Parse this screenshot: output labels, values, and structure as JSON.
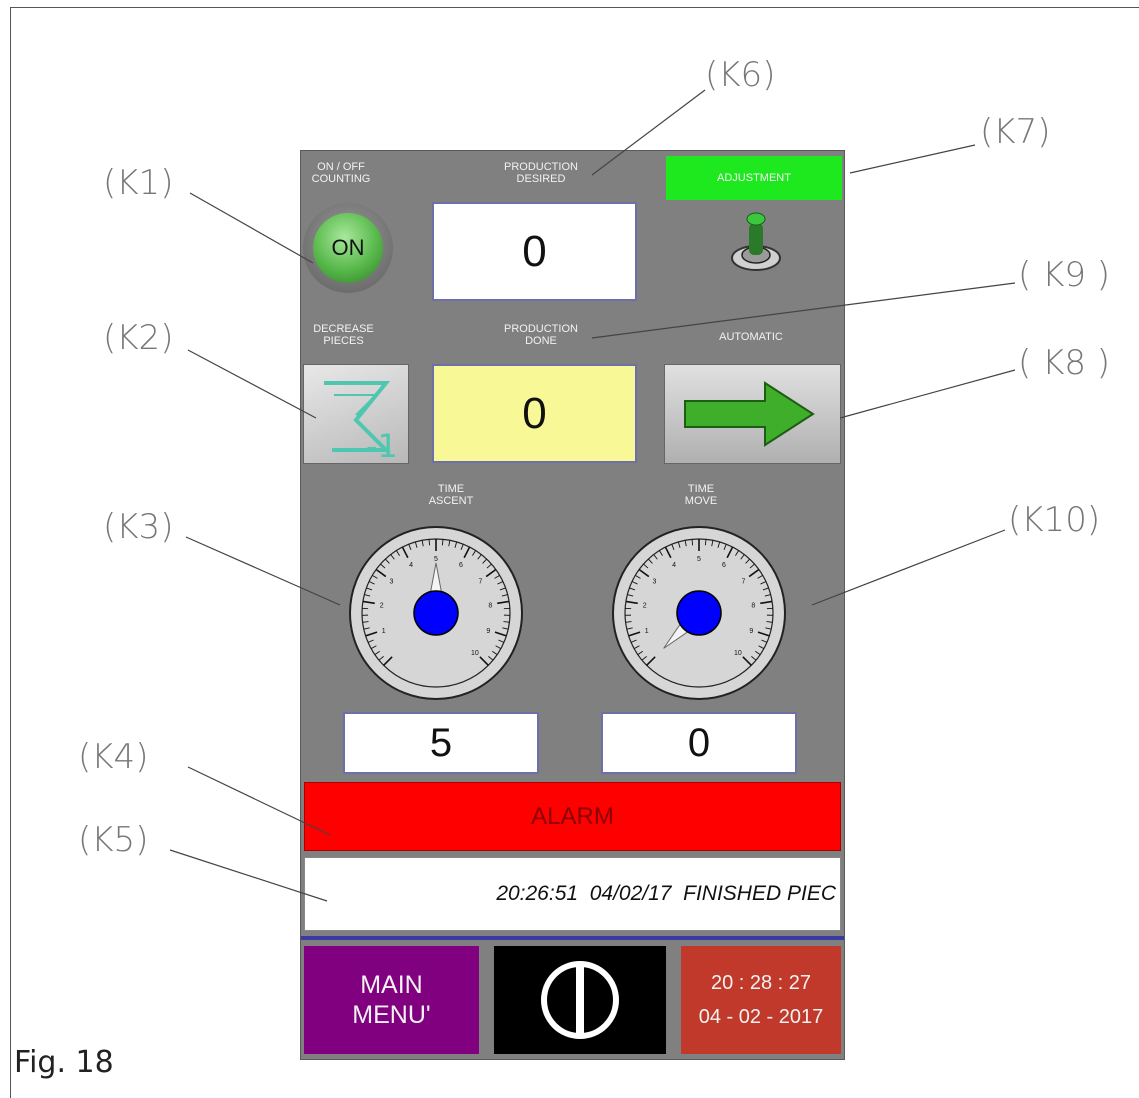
{
  "labels": {
    "on_off": "ON / OFF\nCOUNTING",
    "production_desired": "PRODUCTION\nDESIRED",
    "adjustment": "ADJUSTMENT",
    "decrease": "DECREASE\nPIECES",
    "production_done": "PRODUCTION\nDONE",
    "automatic": "AUTOMATIC",
    "time_ascent": "TIME\nASCENT",
    "time_move": "TIME\nMOVE"
  },
  "on_button": "ON",
  "production_desired_value": "0",
  "production_done_value": "0",
  "time_ascent_value": "5",
  "time_move_value": "0",
  "alarm": "ALARM",
  "message": "20:26:51  04/02/17  FINISHED PIEC",
  "main_menu": "MAIN\nMENU'",
  "clock_time": "20 : 28 : 27",
  "clock_date": "04 - 02 - 2017",
  "figure_label": "Fig. 18",
  "callouts": {
    "k1": "(K1)",
    "k2": "(K2)",
    "k3": "(K3)",
    "k4": "(K4)",
    "k5": "(K5)",
    "k6": "(K6)",
    "k7": "(K7)",
    "k8": "( K8 )",
    "k9": "( K9 )",
    "k10": "(K10)"
  },
  "gauge_ticks": [
    "1",
    "2",
    "3",
    "4",
    "5",
    "6",
    "7",
    "8",
    "9",
    "10"
  ],
  "gauges": {
    "ascent_needle": 5,
    "move_needle": 0
  },
  "colors": {
    "panel": "#808080",
    "on_green": "#57b84a",
    "adjustment_green": "#1ee81e",
    "production_done_bg": "#f8f896",
    "alarm_red": "#ff0000",
    "gauge_blue": "#0000ff",
    "menu_purple": "#800080",
    "clock_red": "#c0392b"
  },
  "icons": [
    "power-icon",
    "sigma-minus-one-icon",
    "right-arrow-icon",
    "toggle-switch-icon"
  ]
}
